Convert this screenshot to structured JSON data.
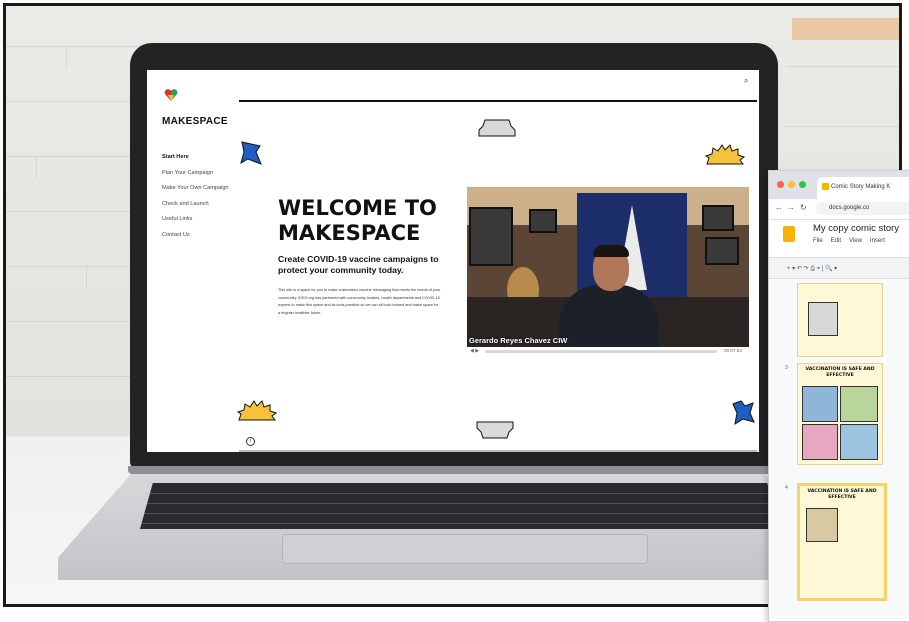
{
  "site": {
    "brand": "MAKESPACE",
    "nav": [
      "Start Here",
      "Plan Your Campaign",
      "Make Your Own Campaign",
      "Check and Launch",
      "Useful Links",
      "Contact Us"
    ],
    "active_nav": "Start Here",
    "hero": {
      "title": "WELCOME TO MAKESPACE",
      "subtitle": "Create COVID-19 vaccine campaigns to protect your community today.",
      "body": "This site is a space for you to make customized vaccine messaging that meets the needs of your community. IDEO.org has partnered with community leaders, health departments and COVID-19 experts to make this space and its tools possible so we can all look forward and make space for a brighter healthier future."
    },
    "video": {
      "caption": "Gerardo Reyes Chavez CIW",
      "duration": "00:07:53",
      "progress": 0
    },
    "icons": {
      "search": "search-icon",
      "info": "info-icon",
      "play": "play-icon",
      "logo": "heart-logo-icon"
    },
    "colors": {
      "accent_blue": "#1f5fbf",
      "accent_yellow": "#f6c23e",
      "logo_red": "#d9342b",
      "logo_green": "#2e9e4f"
    }
  },
  "slides_window": {
    "tab_title": "Comic Story Making K",
    "url": "docs.google.co",
    "doc_title": "My copy comic story",
    "menu": [
      "File",
      "Edit",
      "View",
      "Insert"
    ],
    "toolbar_glyphs": "+ ▾ ↶ ↷ ⎙ ⌖ | 🔍 ▾",
    "slides": [
      {
        "number": "3",
        "title": "VACCINATION IS SAFE AND EFFECTIVE"
      },
      {
        "number": "4",
        "title": "VACCINATION IS SAFE AND EFFECTIVE"
      }
    ]
  }
}
